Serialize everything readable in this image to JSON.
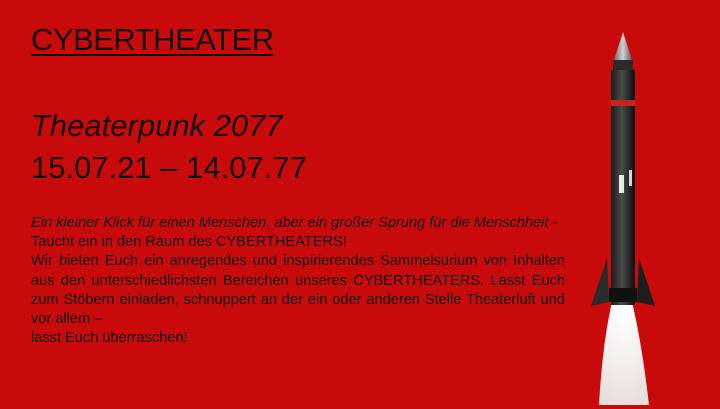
{
  "slide": {
    "heading": "CYBERTHEATER",
    "subtitle": "Theaterpunk 2077",
    "dates": "15.07.21 – 14.07.77",
    "quote": "Ein kleiner Klick für einen Menschen, aber ein großer Sprung für die Menschheit -",
    "line1": "Taucht ein in den Raum des CYBERTHEATERS!",
    "paragraph": "Wir bieten Euch ein anregendes und inspirierendes Sammelsurium von Inhalten aus den unterschiedlichsten Bereichen unseres CYBERTHEATERS. Lasst Euch zum Stöbern einladen, schnuppert an der ein oder anderen Stelle Theaterluft und vor allem –",
    "last_line": "lasst Euch überraschen!"
  },
  "colors": {
    "background": "#c80a0a",
    "text": "#111111"
  },
  "icons": {
    "rocket": "rocket-icon"
  }
}
